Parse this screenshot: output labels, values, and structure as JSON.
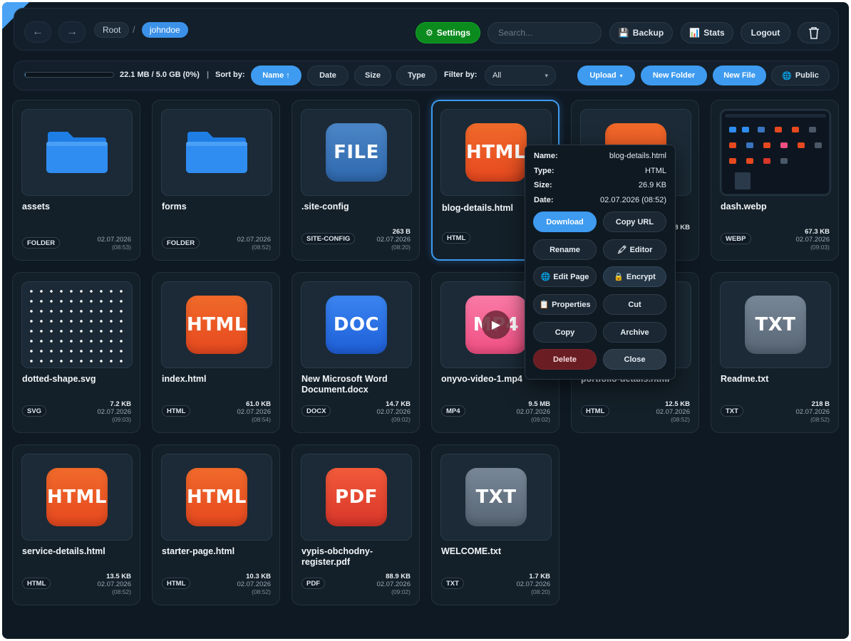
{
  "nav": {
    "back_icon": "←",
    "forward_icon": "→"
  },
  "breadcrumb": {
    "root": "Root",
    "separator": "/",
    "current": "johndoe"
  },
  "header": {
    "settings_icon": "⚙",
    "settings_label": "Settings",
    "search_placeholder": "Search...",
    "backup_icon": "💾",
    "backup_label": "Backup",
    "stats_icon": "📊",
    "stats_label": "Stats",
    "logout_label": "Logout",
    "trash_icon": "trash-icon"
  },
  "toolbar": {
    "storage_text": "22.1 MB / 5.0 GB (0%)",
    "storage_fraction": 0.0044,
    "sort_label": "Sort by:",
    "sort_options": [
      "Name ↑",
      "Date",
      "Size",
      "Type"
    ],
    "sort_active": "Name ↑",
    "filter_label": "Filter by:",
    "filter_value": "All",
    "filter_caret": "▾",
    "upload_label": "Upload",
    "upload_caret": "▾",
    "new_folder_label": "New Folder",
    "new_file_label": "New File",
    "public_icon": "🌐",
    "public_label": "Public"
  },
  "files": [
    {
      "name": "assets",
      "icon": "folder-icon",
      "badge": "FOLDER",
      "size": "",
      "date": "02.07.2026",
      "time": "(08:53)"
    },
    {
      "name": "forms",
      "icon": "folder-icon",
      "badge": "FOLDER",
      "size": "",
      "date": "02.07.2026",
      "time": "(08:52)"
    },
    {
      "name": ".site-config",
      "icon": "FILE",
      "badge": "SITE-CONFIG",
      "size": "263 B",
      "date": "02.07.2026",
      "time": "(08:20)"
    },
    {
      "name": "blog-details.html",
      "icon": "HTML",
      "badge": "HTML",
      "size": "",
      "date": "02.07.2026",
      "time": "(08:52)"
    },
    {
      "name": "",
      "icon": "HTML",
      "badge": "",
      "size": "8 KB",
      "date": "",
      "time": ""
    },
    {
      "name": "dash.webp",
      "icon": "screenshot-thumbnail",
      "badge": "WEBP",
      "size": "67.3 KB",
      "date": "02.07.2026",
      "time": "(09:03)"
    },
    {
      "name": "dotted-shape.svg",
      "icon": "dotted-pattern",
      "badge": "SVG",
      "size": "7.2 KB",
      "date": "02.07.2026",
      "time": "(09:03)"
    },
    {
      "name": "index.html",
      "icon": "HTML",
      "badge": "HTML",
      "size": "61.0 KB",
      "date": "02.07.2026",
      "time": "(08:54)"
    },
    {
      "name": "New Microsoft Word Document.docx",
      "icon": "DOC",
      "badge": "DOCX",
      "size": "14.7 KB",
      "date": "02.07.2026",
      "time": "(09:02)"
    },
    {
      "name": "onyvo-video-1.mp4",
      "icon": "MP4",
      "badge": "MP4",
      "size": "9.5 MB",
      "date": "02.07.2026",
      "time": "(09:02)"
    },
    {
      "name": "portfolio-details.html",
      "icon": "HTML",
      "badge": "HTML",
      "size": "12.5 KB",
      "date": "02.07.2026",
      "time": "(08:52)"
    },
    {
      "name": "Readme.txt",
      "icon": "TXT",
      "badge": "TXT",
      "size": "218 B",
      "date": "02.07.2026",
      "time": "(08:52)"
    },
    {
      "name": "service-details.html",
      "icon": "HTML",
      "badge": "HTML",
      "size": "13.5 KB",
      "date": "02.07.2026",
      "time": "(08:52)"
    },
    {
      "name": "starter-page.html",
      "icon": "HTML",
      "badge": "HTML",
      "size": "10.3 KB",
      "date": "02.07.2026",
      "time": "(08:52)"
    },
    {
      "name": "vypis-obchodny-register.pdf",
      "icon": "PDF",
      "badge": "PDF",
      "size": "88.9 KB",
      "date": "02.07.2026",
      "time": "(09:02)"
    },
    {
      "name": "WELCOME.txt",
      "icon": "TXT",
      "badge": "TXT",
      "size": "1.7 KB",
      "date": "02.07.2026",
      "time": "(08:20)"
    }
  ],
  "context_menu": {
    "name_key": "Name:",
    "name_val": "blog-details.html",
    "type_key": "Type:",
    "type_val": "HTML",
    "size_key": "Size:",
    "size_val": "26.9 KB",
    "date_key": "Date:",
    "date_val": "02.07.2026 (08:52)",
    "download": "Download",
    "copy_url": "Copy URL",
    "rename": "Rename",
    "editor_icon": "🖍",
    "editor": "Editor",
    "edit_page_icon": "🌐",
    "edit_page": "Edit Page",
    "encrypt_icon": "🔒",
    "encrypt": "Encrypt",
    "properties_icon": "📋",
    "properties": "Properties",
    "cut": "Cut",
    "copy": "Copy",
    "archive": "Archive",
    "delete": "Delete",
    "close": "Close"
  },
  "colors": {
    "accent": "#3e9bf0",
    "settings_green": "#0b8a1d",
    "delete_red": "#6a1d22",
    "background": "#0f1923"
  }
}
